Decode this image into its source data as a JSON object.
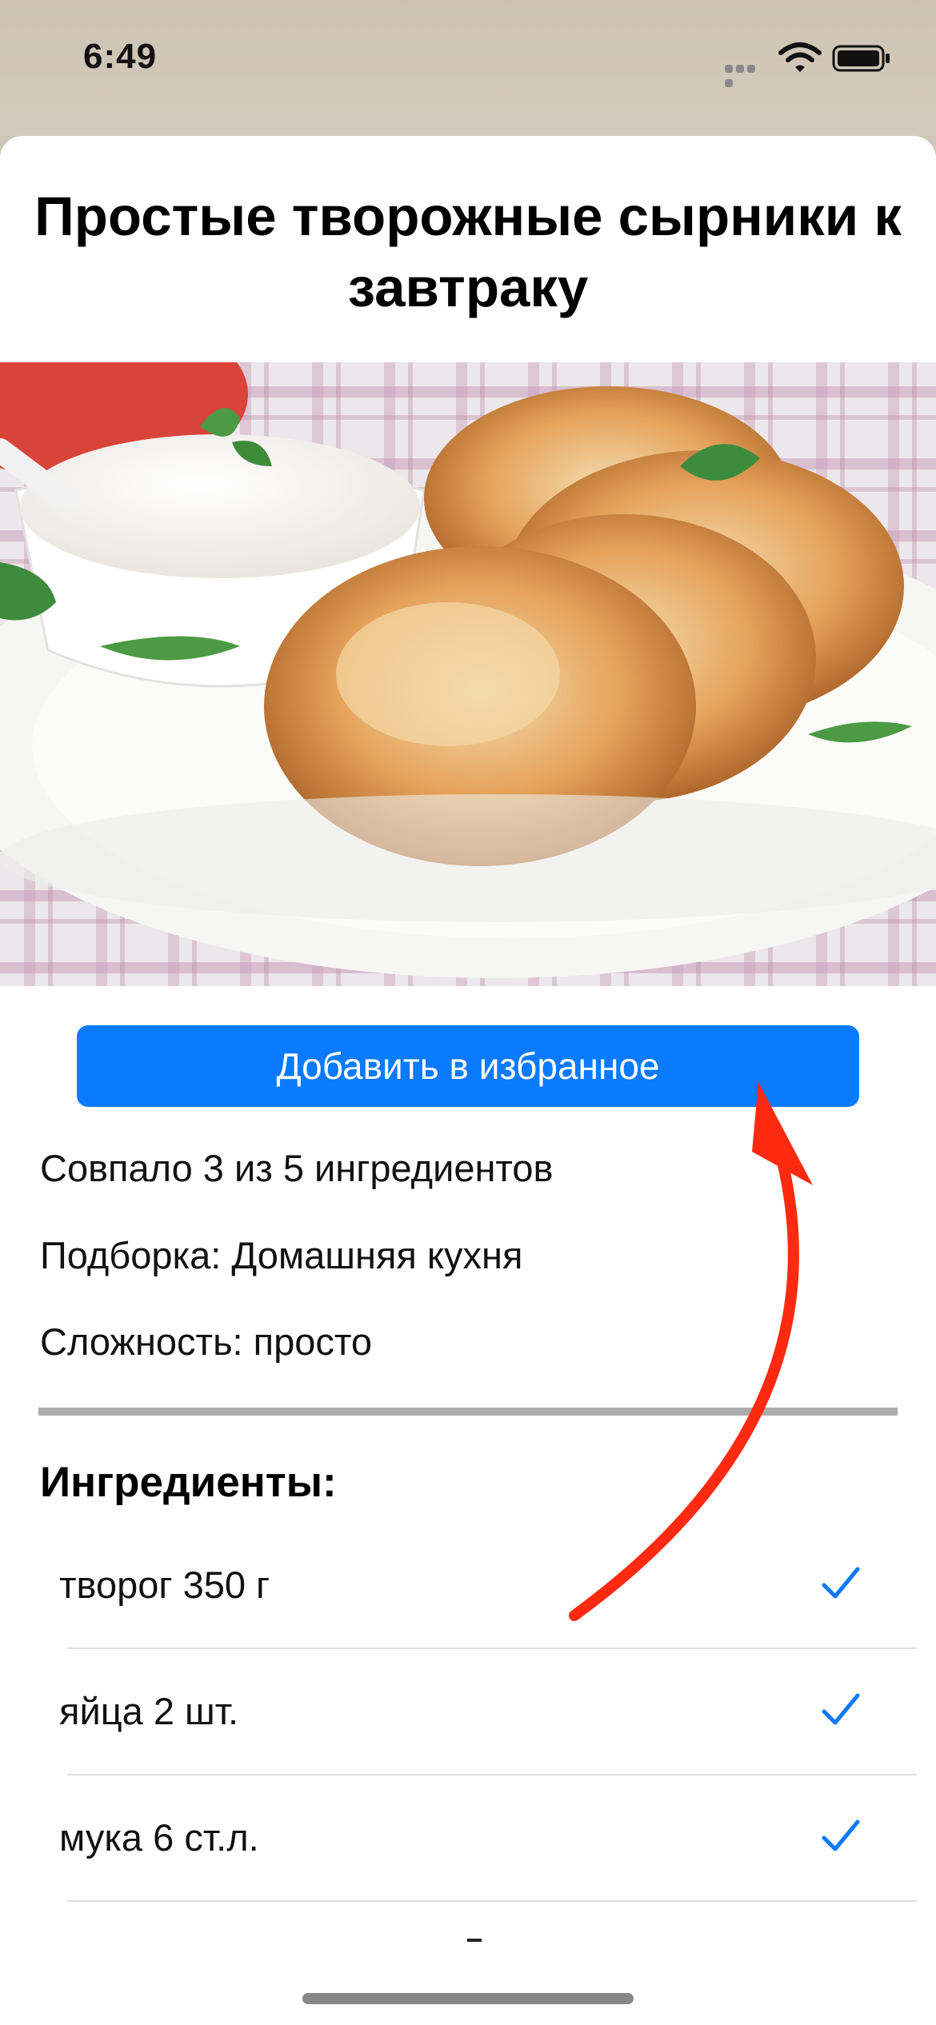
{
  "status_bar": {
    "time": "6:49"
  },
  "recipe": {
    "title": "Простые творожные сырники к завтраку"
  },
  "actions": {
    "favorite_label": "Добавить в избранное"
  },
  "info": {
    "matched": "Совпало 3 из 5 ингредиентов",
    "collection": "Подборка:  Домашняя кухня",
    "difficulty": "Сложность:  просто"
  },
  "ingredients": {
    "heading": "Ингредиенты:",
    "items": [
      {
        "name": "творог 350 г",
        "checked": true
      },
      {
        "name": "яйца 2 шт.",
        "checked": true
      },
      {
        "name": "мука 6 ст.л.",
        "checked": true
      }
    ]
  },
  "colors": {
    "accent": "#0a7aff",
    "annotation_arrow": "#ff2a10",
    "divider": "#ababab"
  },
  "icons": [
    "signal-icon",
    "wifi-icon",
    "battery-icon",
    "check-icon"
  ]
}
